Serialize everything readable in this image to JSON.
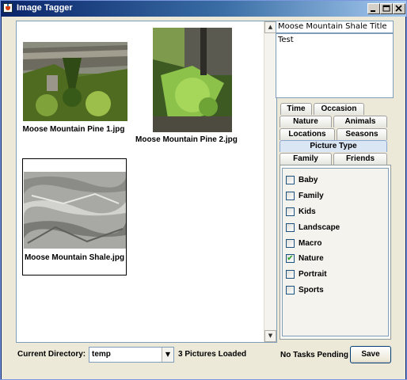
{
  "window": {
    "title": "Image Tagger"
  },
  "gallery": {
    "items": [
      {
        "filename": "Moose Mountain Pine 1.jpg"
      },
      {
        "filename": "Moose Mountain Pine 2.jpg"
      },
      {
        "filename": "Moose Mountain Shale.jpg"
      }
    ]
  },
  "details": {
    "title": "Moose Mountain Shale Title",
    "description": "Test"
  },
  "tabs": [
    {
      "label": "Time"
    },
    {
      "label": "Occasion"
    },
    {
      "label": "Nature"
    },
    {
      "label": "Animals"
    },
    {
      "label": "Locations"
    },
    {
      "label": "Seasons"
    },
    {
      "label": "Picture Type"
    },
    {
      "label": "Family"
    },
    {
      "label": "Friends"
    }
  ],
  "active_tab": "Picture Type",
  "tags": [
    {
      "label": "Baby",
      "checked": false
    },
    {
      "label": "Family",
      "checked": false
    },
    {
      "label": "Kids",
      "checked": false
    },
    {
      "label": "Landscape",
      "checked": false
    },
    {
      "label": "Macro",
      "checked": false
    },
    {
      "label": "Nature",
      "checked": true
    },
    {
      "label": "Portrait",
      "checked": false
    },
    {
      "label": "Sports",
      "checked": false
    }
  ],
  "status": {
    "directory_label": "Current Directory:",
    "directory_value": "temp",
    "loaded_text": "3 Pictures Loaded",
    "tasks_text": "No Tasks Pending",
    "save_label": "Save"
  },
  "colors": {
    "title_gradient_start": "#0a246a",
    "title_gradient_end": "#a6caf0",
    "window_bg": "#ece9d8",
    "check_mark": "#21a121"
  }
}
